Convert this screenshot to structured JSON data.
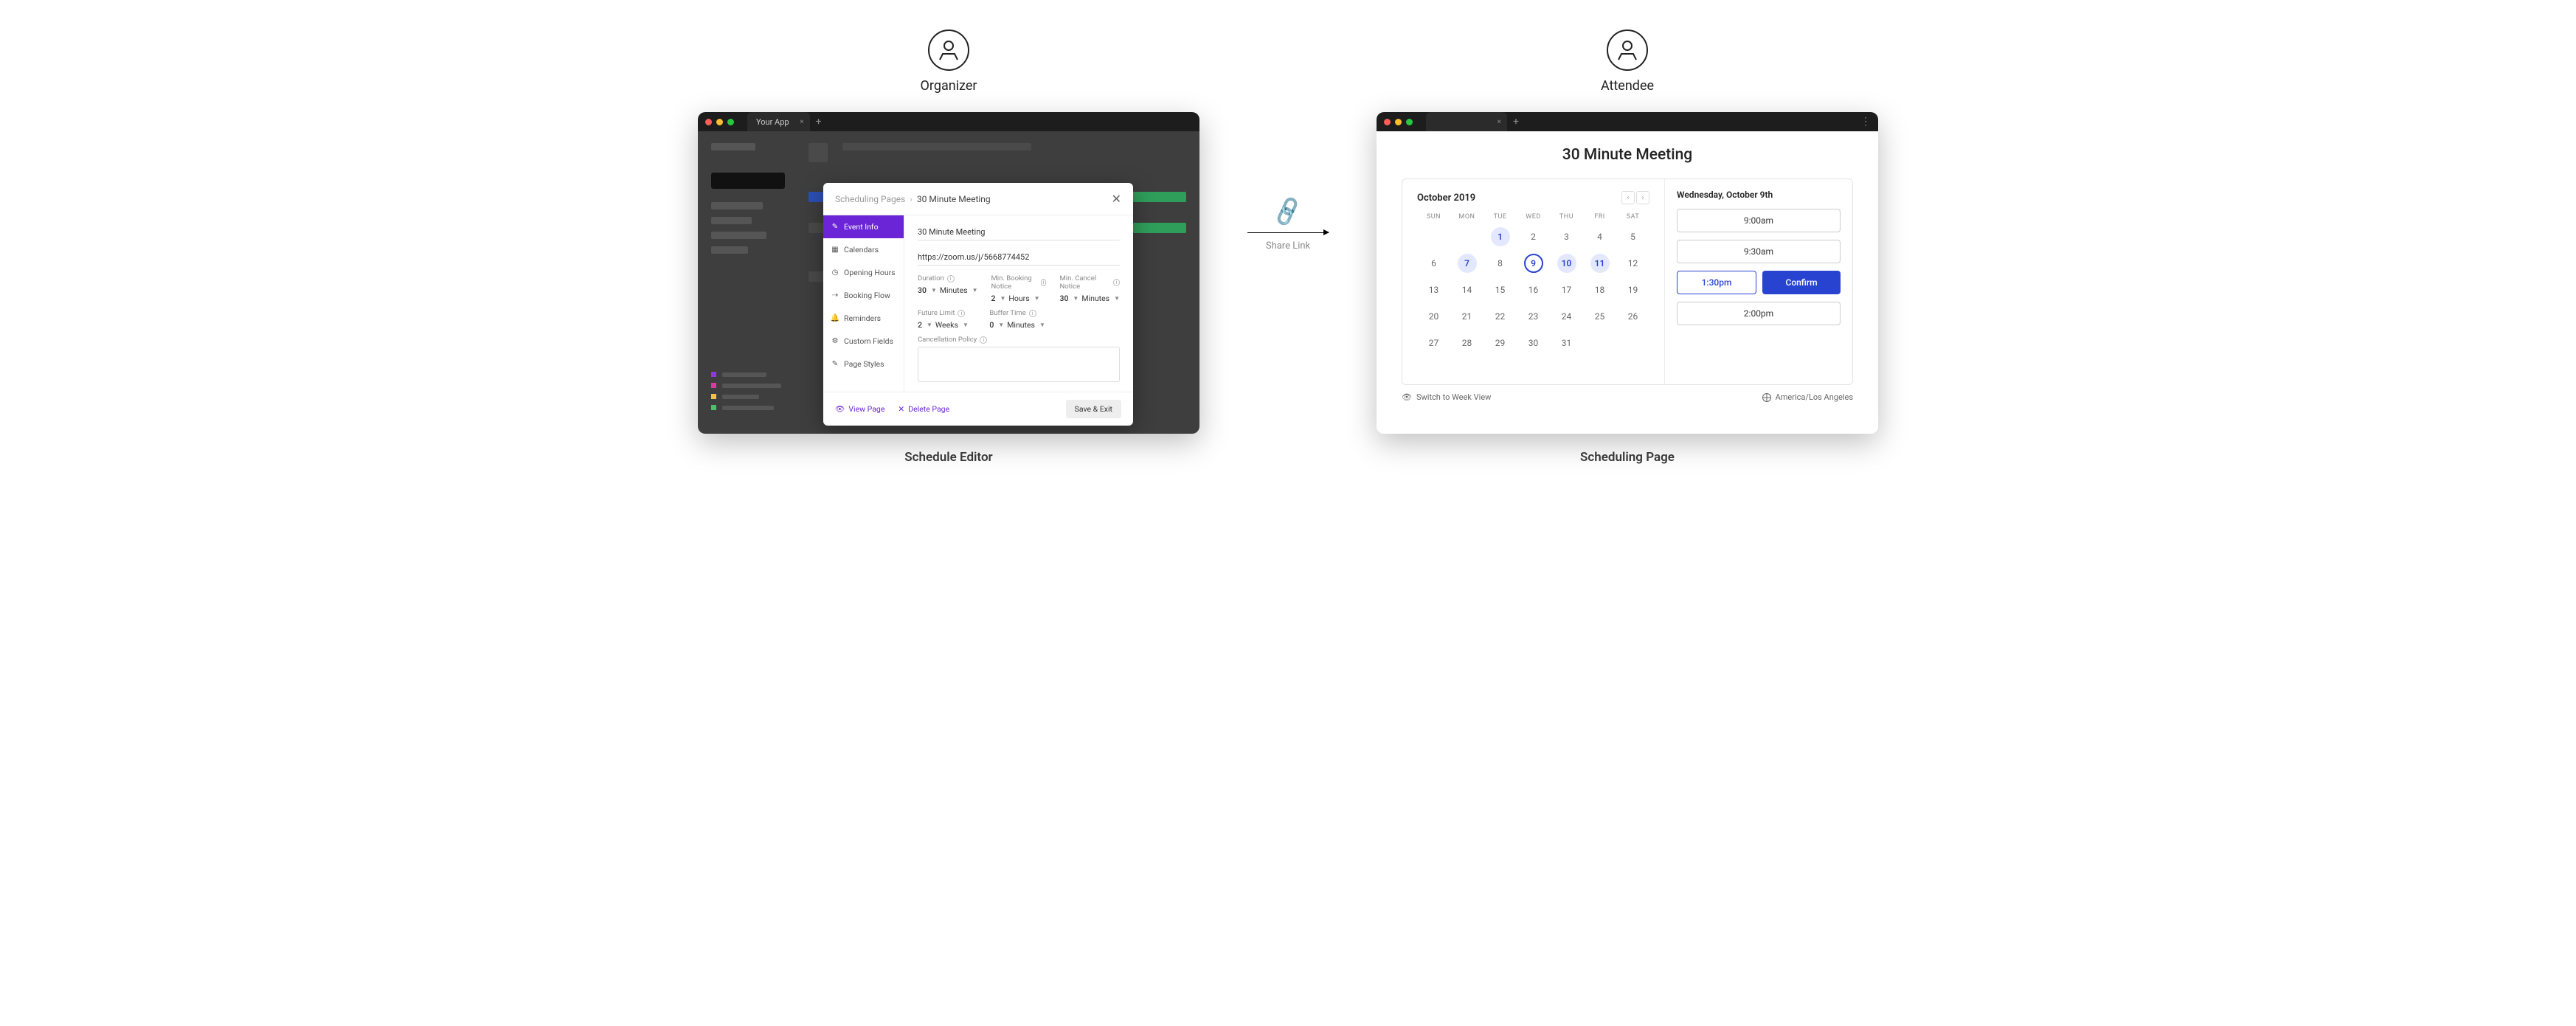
{
  "personas": {
    "organizer": "Organizer",
    "attendee": "Attendee"
  },
  "captions": {
    "editor": "Schedule Editor",
    "page": "Scheduling Page"
  },
  "connector": {
    "label": "Share Link"
  },
  "editor_window": {
    "tab_title": "Your App",
    "modal": {
      "breadcrumb_root": "Scheduling Pages",
      "breadcrumb_current": "30 Minute Meeting",
      "side_tabs": [
        "Event Info",
        "Calendars",
        "Opening Hours",
        "Booking Flow",
        "Reminders",
        "Custom Fields",
        "Page Styles"
      ],
      "fields": {
        "title_value": "30 Minute Meeting",
        "url_value": "https://zoom.us/j/5668774452",
        "duration_label": "Duration",
        "duration_value": "30",
        "duration_unit": "Minutes",
        "min_book_label": "Min. Booking Notice",
        "min_book_value": "2",
        "min_book_unit": "Hours",
        "min_cancel_label": "Min. Cancel Notice",
        "min_cancel_value": "30",
        "min_cancel_unit": "Minutes",
        "future_label": "Future Limit",
        "future_value": "2",
        "future_unit": "Weeks",
        "buffer_label": "Buffer Time",
        "buffer_value": "0",
        "buffer_unit": "Minutes",
        "cancel_policy_label": "Cancellation Policy"
      },
      "footer": {
        "view": "View Page",
        "delete": "Delete Page",
        "save": "Save & Exit"
      }
    }
  },
  "attendee_window": {
    "title": "30 Minute Meeting",
    "month": "October 2019",
    "dow": [
      "SUN",
      "MON",
      "TUE",
      "WED",
      "THU",
      "FRI",
      "SAT"
    ],
    "weeks": [
      [
        "",
        "",
        "1",
        "2",
        "3",
        "4",
        "5"
      ],
      [
        "6",
        "7",
        "8",
        "9",
        "10",
        "11",
        "12"
      ],
      [
        "13",
        "14",
        "15",
        "16",
        "17",
        "18",
        "19"
      ],
      [
        "20",
        "21",
        "22",
        "23",
        "24",
        "25",
        "26"
      ],
      [
        "27",
        "28",
        "29",
        "30",
        "31",
        "",
        ""
      ]
    ],
    "available_days": [
      "1",
      "7",
      "9",
      "10",
      "11"
    ],
    "selected_day": "9",
    "selected_date_label": "Wednesday, October 9th",
    "slots": [
      "9:00am",
      "9:30am",
      "1:30pm",
      "2:00pm"
    ],
    "selected_slot": "1:30pm",
    "confirm_label": "Confirm",
    "footer": {
      "switch_view": "Switch to Week View",
      "timezone": "America/Los Angeles"
    }
  }
}
